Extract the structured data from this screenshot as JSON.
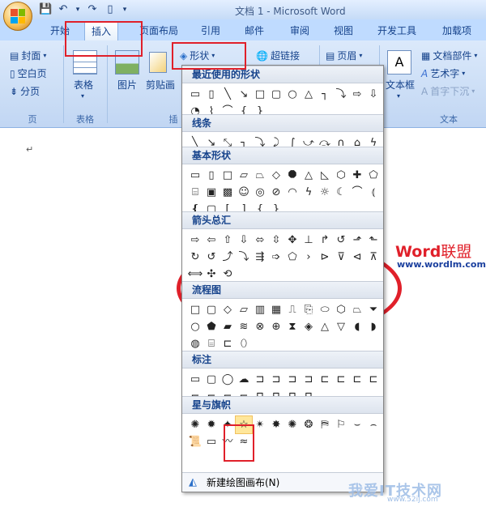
{
  "window": {
    "title": "文档 1 - Microsoft Word"
  },
  "tabs": [
    {
      "label": "开始"
    },
    {
      "label": "插入"
    },
    {
      "label": "页面布局"
    },
    {
      "label": "引用"
    },
    {
      "label": "邮件"
    },
    {
      "label": "审阅"
    },
    {
      "label": "视图"
    },
    {
      "label": "开发工具"
    },
    {
      "label": "加载项"
    }
  ],
  "ribbon": {
    "pages": {
      "cover": "封面",
      "blank": "空白页",
      "break": "分页",
      "label": "页"
    },
    "table": {
      "button": "表格",
      "label": "表格"
    },
    "illustrations": {
      "picture": "图片",
      "clipart": "剪贴画",
      "shapes": "形状",
      "label_partial": "插"
    },
    "links": {
      "hyperlink": "超链接"
    },
    "header": {
      "button": "页眉"
    },
    "text": {
      "textbox": "文本框",
      "quickparts": "文档部件",
      "wordart": "艺术字",
      "dropcap": "首字下沉",
      "label": "文本"
    }
  },
  "dropdown": {
    "sections": [
      {
        "title": "最近使用的形状",
        "shapes": [
          "text-box",
          "vertical-text-box",
          "line",
          "arrow",
          "rect",
          "rounded-rect",
          "oval",
          "triangle",
          "elbow",
          "elbow-arrow",
          "block-right",
          "block-down",
          "moon-leaf",
          "squiggle",
          "arc",
          "left-brace",
          "right-brace"
        ]
      },
      {
        "title": "线条",
        "shapes": [
          "line",
          "arrow",
          "double-arrow",
          "elbow",
          "elbow-arrow",
          "elbow-double",
          "curve",
          "curve-arrow",
          "curve-double",
          "freeform-curve",
          "freeform",
          "scribble"
        ]
      },
      {
        "title": "基本形状",
        "shapes": [
          "text-box",
          "vertical-text-box",
          "rect",
          "parallelogram",
          "trapezoid",
          "diamond",
          "octagon",
          "triangle",
          "right-triangle",
          "hexagon",
          "cross",
          "pentagon",
          "cylinder",
          "cube",
          "bevel",
          "smiley",
          "donut",
          "no-symbol",
          "block-arc",
          "lightning",
          "sun",
          "moon",
          "arc",
          "bracket-pair",
          "brace-pair",
          "plaque",
          "left-bracket",
          "right-bracket",
          "left-brace",
          "right-brace"
        ]
      },
      {
        "title": "箭头总汇",
        "shapes": [
          "right-arrow",
          "left-arrow",
          "up-arrow",
          "down-arrow",
          "left-right-arrow",
          "up-down-arrow",
          "quad-arrow",
          "left-right-up-arrow",
          "bent-arrow",
          "u-turn-arrow",
          "left-up-arrow",
          "bent-up-arrow",
          "curved-right-arrow",
          "curved-left-arrow",
          "curved-up-arrow",
          "curved-down-arrow",
          "striped-right-arrow",
          "notched-right-arrow",
          "pentagon-arrow",
          "chevron",
          "right-callout-arrow",
          "down-callout-arrow",
          "left-callout-arrow",
          "up-callout-arrow",
          "left-right-callout",
          "quad-callout",
          "circular-arrow"
        ]
      },
      {
        "title": "流程图",
        "shapes": [
          "process",
          "alt-process",
          "decision",
          "data",
          "predefined",
          "internal-storage",
          "document",
          "multidocument",
          "terminator",
          "preparation",
          "manual-input",
          "manual-operation",
          "connector",
          "offpage",
          "card",
          "punched-tape",
          "summing-junction",
          "or",
          "collate",
          "sort",
          "extract",
          "merge",
          "stored-data",
          "delay",
          "sequential-storage",
          "magnetic-disk",
          "direct-access",
          "display"
        ]
      },
      {
        "title": "标注",
        "shapes": [
          "rect-callout",
          "rounded-callout",
          "oval-callout",
          "cloud-callout",
          "line-callout-1",
          "line-callout-2",
          "line-callout-3",
          "line-callout-4",
          "line-callout-1-accent",
          "line-callout-2-accent",
          "line-callout-3-accent",
          "line-callout-4-accent",
          "line-callout-1-noborder",
          "line-callout-2-noborder",
          "line-callout-3-noborder",
          "line-callout-4-noborder",
          "line-callout-1-border",
          "line-callout-2-border",
          "line-callout-3-border",
          "line-callout-4-border"
        ]
      },
      {
        "title": "星与旗帜",
        "shapes": [
          "explosion-1",
          "explosion-2",
          "star-4",
          "star-5",
          "star-8",
          "star-16",
          "star-24",
          "star-32",
          "up-ribbon",
          "down-ribbon",
          "curved-up-ribbon",
          "curved-down-ribbon",
          "vertical-scroll",
          "horizontal-scroll",
          "wave",
          "double-wave"
        ]
      }
    ],
    "footer": {
      "label": "新建绘图画布(N)"
    }
  },
  "document": {
    "paragraph_mark": "↵"
  },
  "watermarks": {
    "brand_w": "Word",
    "brand_rest": "联盟",
    "url": "www.wordlm.com",
    "bottom_brand": "我爱IT技术网",
    "bottom_url": "www.52ij.com"
  },
  "colors": {
    "annotation_red": "#e0202a",
    "ribbon_bg": "#c9dcf5",
    "tab_text": "#15428b"
  }
}
